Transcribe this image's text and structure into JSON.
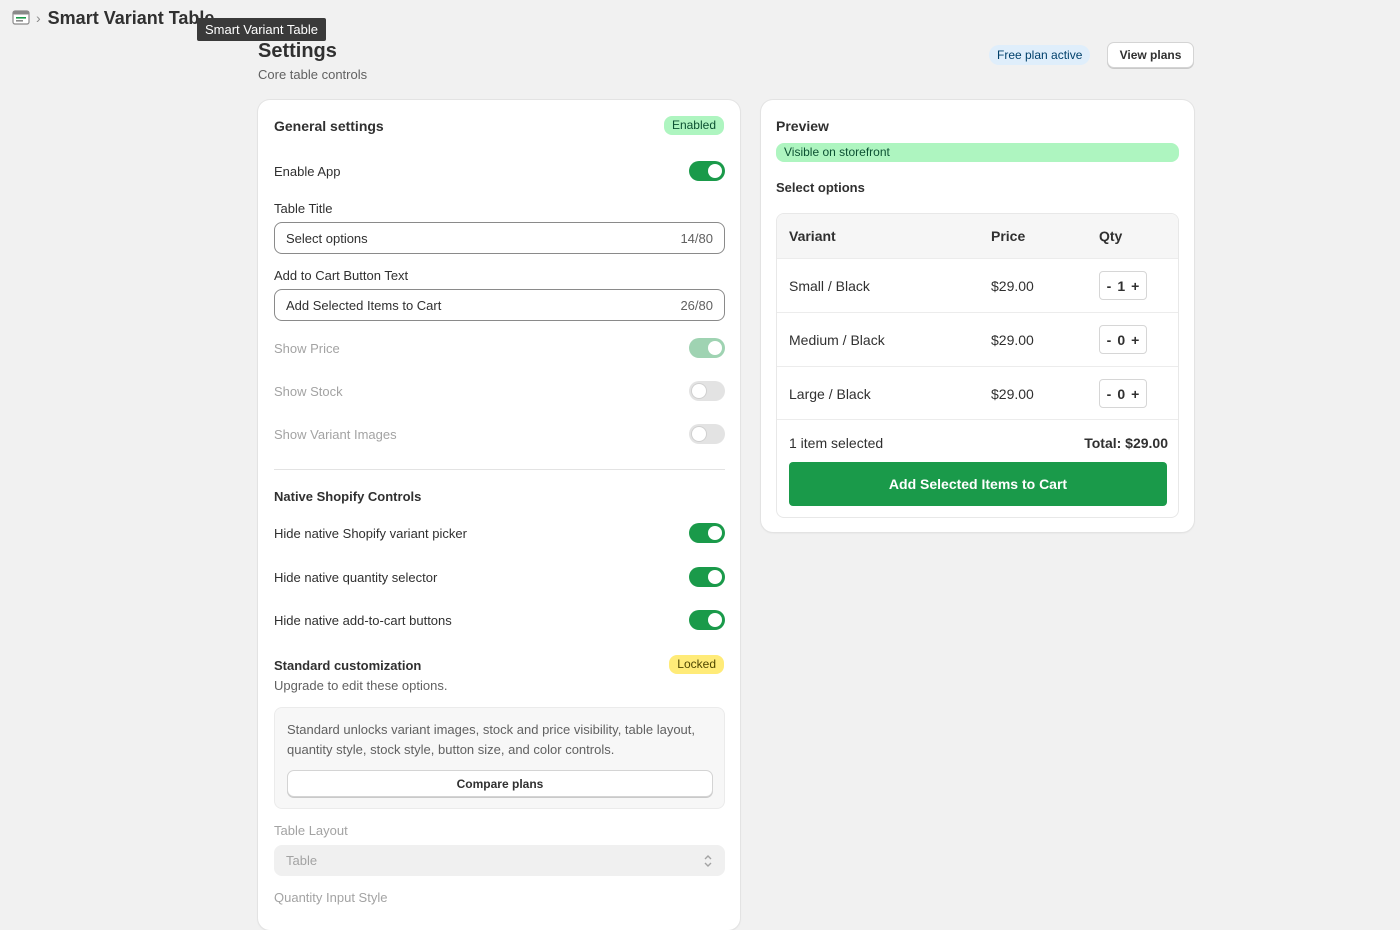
{
  "topbar": {
    "app_icon": "app-window-icon",
    "separator": "›",
    "app_title": "Smart Variant Table",
    "tooltip": "Smart Variant Table"
  },
  "header": {
    "title": "Settings",
    "subtitle": "Core table controls",
    "plan_badge": "Free plan active",
    "view_plans": "View plans"
  },
  "settings": {
    "title": "General settings",
    "status_badge": "Enabled",
    "enable_app": {
      "label": "Enable App",
      "on": true
    },
    "table_title": {
      "label": "Table Title",
      "value": "Select options",
      "count": "14/80"
    },
    "cart_button_text": {
      "label": "Add to Cart Button Text",
      "value": "Add Selected Items to Cart",
      "count": "26/80"
    },
    "show_price": {
      "label": "Show Price",
      "on": true,
      "disabled": true
    },
    "show_stock": {
      "label": "Show Stock",
      "on": false,
      "disabled": true
    },
    "show_variant_images": {
      "label": "Show Variant Images",
      "on": false,
      "disabled": true
    },
    "native_controls": {
      "title": "Native Shopify Controls",
      "items": [
        {
          "label": "Hide native Shopify variant picker",
          "on": true
        },
        {
          "label": "Hide native quantity selector",
          "on": true
        },
        {
          "label": "Hide native add-to-cart buttons",
          "on": true
        }
      ]
    },
    "standard": {
      "title": "Standard customization",
      "badge": "Locked",
      "description": "Upgrade to edit these options.",
      "info": "Standard unlocks variant images, stock and price visibility, table layout, quantity style, stock style, button size, and color controls.",
      "compare_button": "Compare plans"
    },
    "table_layout": {
      "label": "Table Layout",
      "value": "Table"
    },
    "quantity_style": {
      "label": "Quantity Input Style"
    }
  },
  "preview": {
    "title": "Preview",
    "status": "Visible on storefront",
    "table_title": "Select options",
    "columns": [
      "Variant",
      "Price",
      "Qty"
    ],
    "rows": [
      {
        "variant": "Small / Black",
        "price": "$29.00",
        "qty_minus": "-",
        "qty": "1",
        "qty_plus": "+"
      },
      {
        "variant": "Medium / Black",
        "price": "$29.00",
        "qty_minus": "-",
        "qty": "0",
        "qty_plus": "+"
      },
      {
        "variant": "Large / Black",
        "price": "$29.00",
        "qty_minus": "-",
        "qty": "0",
        "qty_plus": "+"
      }
    ],
    "selected_text": "1 item selected",
    "total_text": "Total: $29.00",
    "cart_button": "Add Selected Items to Cart"
  },
  "colors": {
    "accent_green": "#1a9a4a",
    "success_badge": "#aef5c0",
    "locked_badge": "#ffeb78",
    "info_badge": "#dfeefb"
  }
}
